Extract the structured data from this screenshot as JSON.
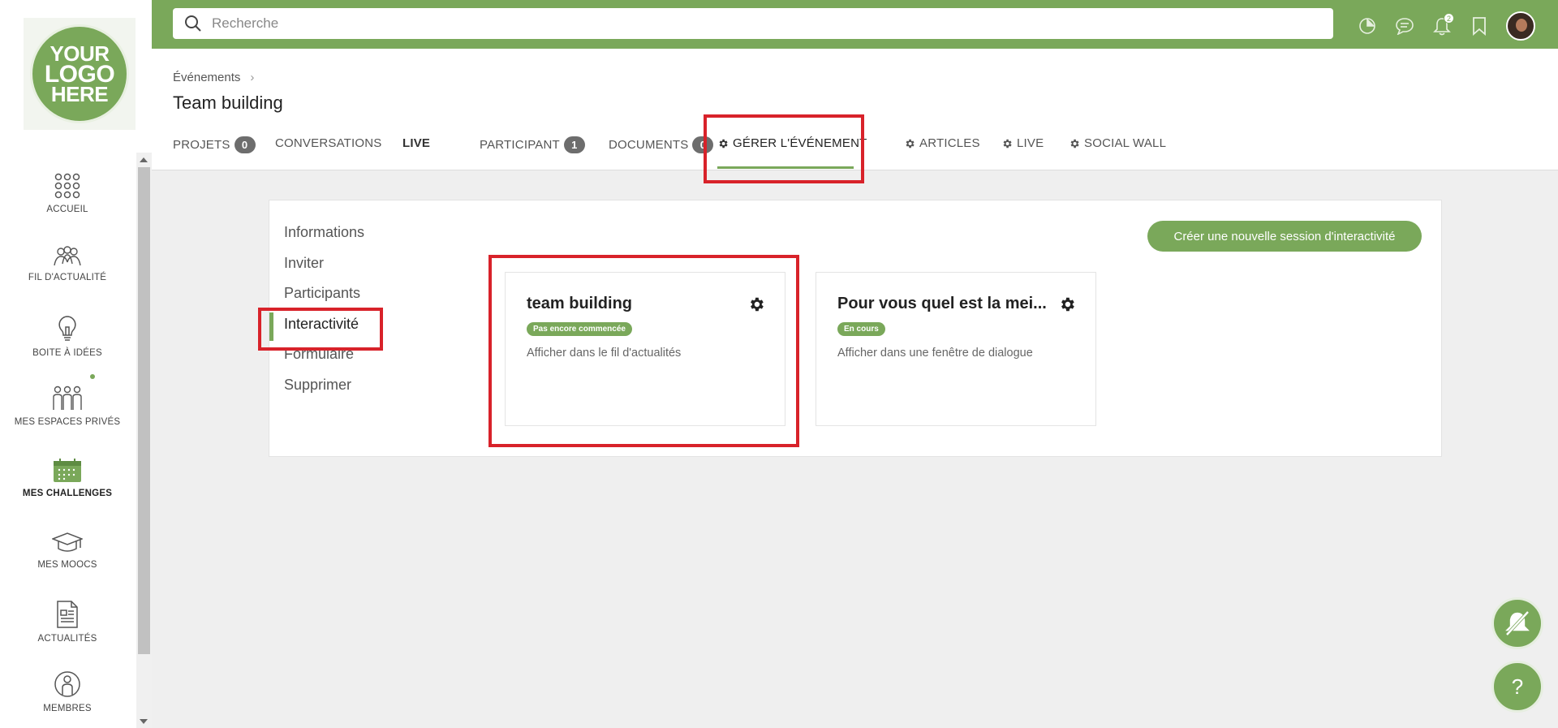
{
  "brand": {
    "logo_lines": [
      "YOUR",
      "LOGO",
      "HERE"
    ],
    "accent": "#7aa85a",
    "highlight": "#d8222a"
  },
  "sidebar": {
    "items": [
      {
        "label": "ACCUEIL",
        "icon": "grid-dots-icon"
      },
      {
        "label": "FIL D'ACTUALITÉ",
        "icon": "people-group-icon"
      },
      {
        "label": "BOITE À IDÉES",
        "icon": "lightbulb-icon"
      },
      {
        "label": "MES ESPACES PRIVÉS",
        "icon": "private-spaces-icon"
      },
      {
        "label": "MES CHALLENGES",
        "icon": "calendar-icon"
      },
      {
        "label": "MES MOOCS",
        "icon": "graduation-cap-icon"
      },
      {
        "label": "ACTUALITÉS",
        "icon": "document-icon"
      },
      {
        "label": "MEMBRES",
        "icon": "member-icon"
      }
    ]
  },
  "topbar": {
    "search_placeholder": "Recherche",
    "notifications_count": "2",
    "icons": [
      "pie-chart-icon",
      "chat-icon",
      "bell-icon",
      "bookmark-icon",
      "avatar"
    ]
  },
  "header": {
    "breadcrumb": "Événements",
    "title": "Team building",
    "tabs": [
      {
        "label": "PROJETS",
        "count": "0"
      },
      {
        "label": "CONVERSATIONS"
      },
      {
        "label": "LIVE"
      },
      {
        "label": "PARTICIPANT",
        "count": "1"
      },
      {
        "label": "DOCUMENTS",
        "count": "0"
      },
      {
        "label": "GÉRER L'ÉVÉNEMENT"
      },
      {
        "label": "ARTICLES"
      },
      {
        "label": "LIVE"
      },
      {
        "label": "SOCIAL WALL"
      }
    ]
  },
  "manage": {
    "menu": [
      "Informations",
      "Inviter",
      "Participants",
      "Interactivité",
      "Formulaire",
      "Supprimer"
    ],
    "new_session_label": "Créer une nouvelle session d'interactivité",
    "cards": [
      {
        "title": "team building",
        "status": "Pas encore commencée",
        "description": "Afficher dans le fil d'actualités"
      },
      {
        "title": "Pour vous quel est la mei...",
        "status": "En cours",
        "description": "Afficher dans une fenêtre de dialogue"
      }
    ]
  },
  "fab": {
    "help_label": "?"
  }
}
